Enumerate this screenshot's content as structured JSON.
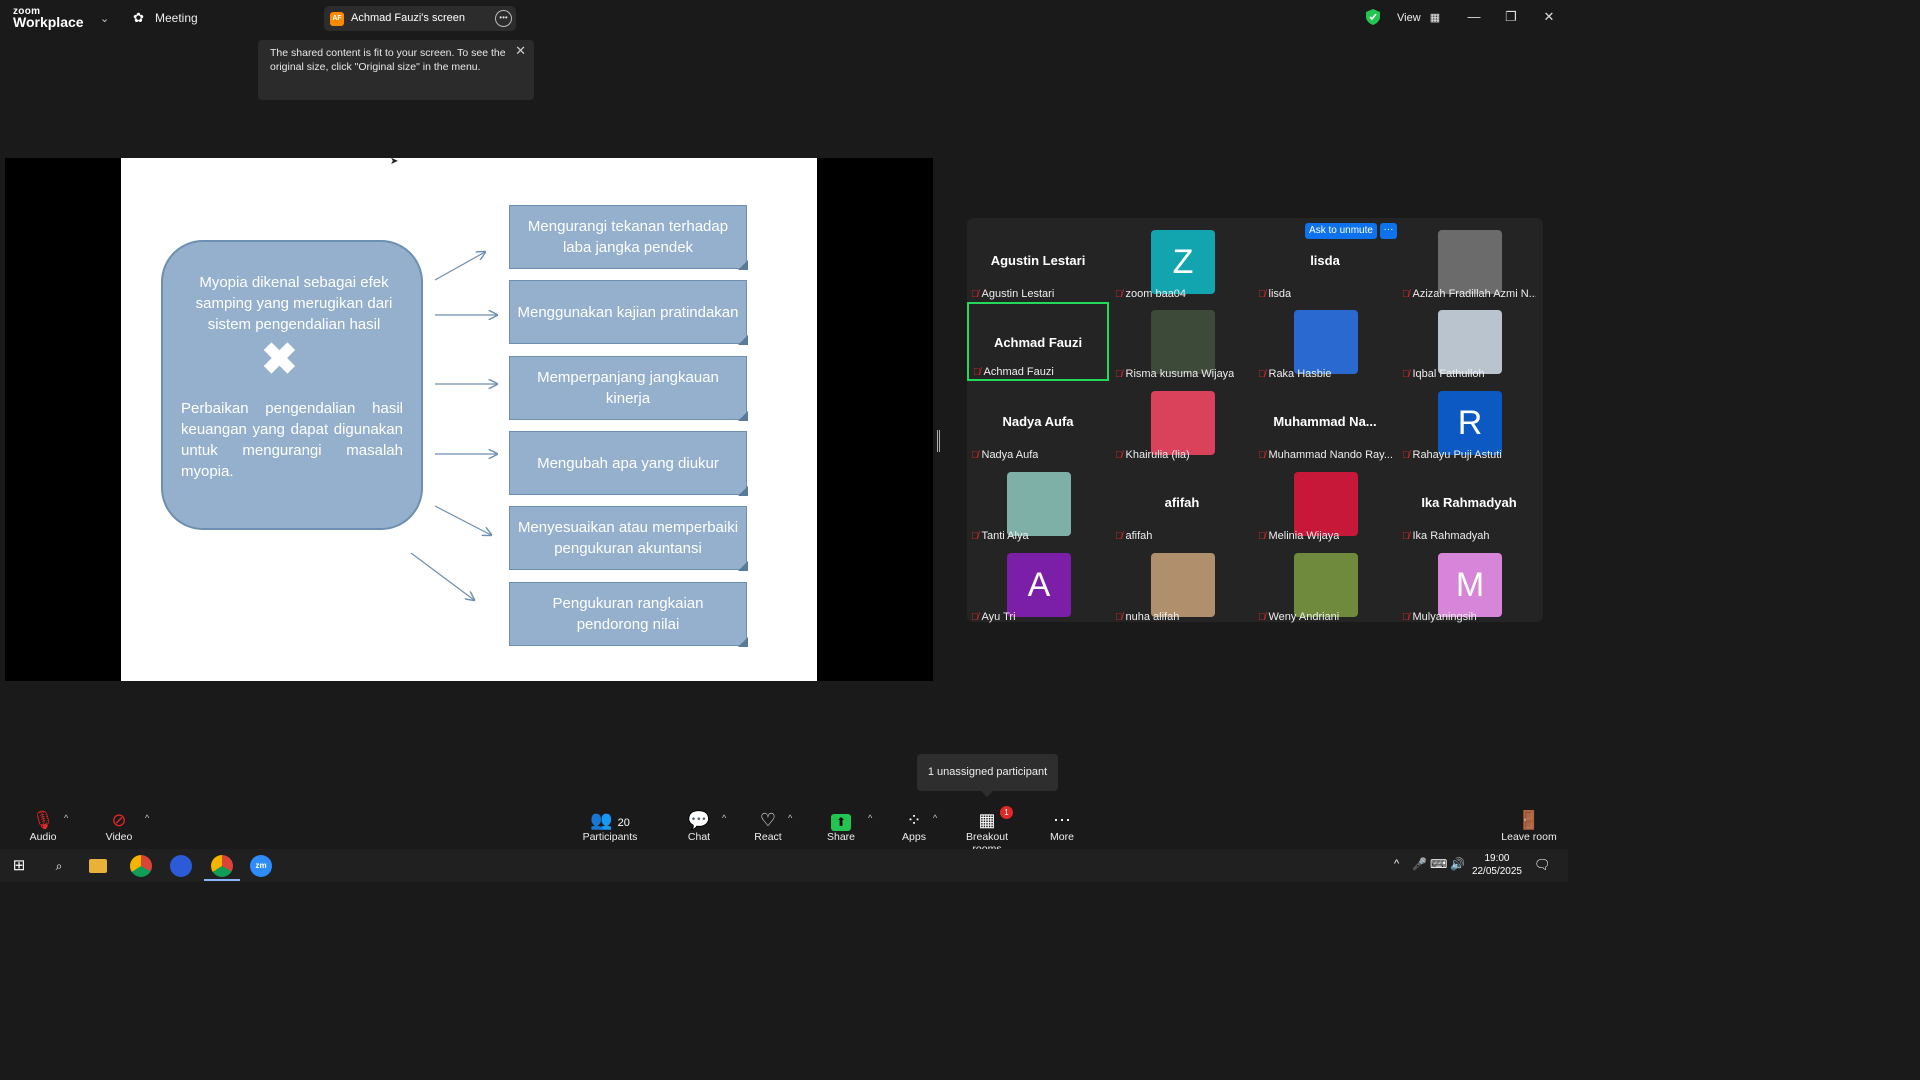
{
  "titlebar": {
    "logo_top": "zoom",
    "logo_bottom": "Workplace",
    "meeting_label": "Meeting",
    "share_initials": "AF",
    "share_title": "Achmad Fauzi's screen",
    "view_label": "View",
    "icons": [
      "chevron-down-icon",
      "meeting-icon",
      "more-icon",
      "shield-icon",
      "grid-icon",
      "minimize-icon",
      "maximize-icon",
      "close-icon"
    ]
  },
  "tooltip": {
    "text": "The shared content is fit to your screen. To see the original size, click \"Original size\" in the menu."
  },
  "slide": {
    "main_text_1": "Myopia dikenal sebagai efek samping yang merugikan dari sistem pengendalian hasil",
    "main_x": "✖",
    "main_text_2": "Perbaikan pengendalian hasil keuangan yang dapat digunakan untuk mengurangi masalah myopia.",
    "boxes": [
      "Mengurangi tekanan terhadap laba jangka pendek",
      "Menggunakan kajian pratindakan",
      "Memperpanjang jangkauan kinerja",
      "Mengubah apa yang diukur",
      "Menyesuaikan atau memperbaiki pengukuran akuntansi",
      "Pengukuran rangkaian pendorong nilai"
    ]
  },
  "gallery": {
    "ask_to_unmute": "Ask to unmute",
    "ask_more": "···",
    "tiles": [
      {
        "name": "Agustin Lestari",
        "label": "Agustin Lestari",
        "type": "name"
      },
      {
        "name": "Z",
        "label": "zoom baa04",
        "type": "letter",
        "color": "#12a5b0"
      },
      {
        "name": "lisda",
        "label": "lisda",
        "type": "name"
      },
      {
        "name": "",
        "label": "Azizah Fradillah Azmi N...",
        "type": "photo",
        "color": "#6b6b6b"
      },
      {
        "name": "Achmad Fauzi",
        "label": "Achmad Fauzi",
        "type": "name",
        "active": true
      },
      {
        "name": "",
        "label": "Risma kusuma Wijaya",
        "type": "photo",
        "color": "#3d4a3a"
      },
      {
        "name": "",
        "label": "Raka Hasbie",
        "type": "photo",
        "color": "#2a6ad0"
      },
      {
        "name": "",
        "label": "Iqbal Fathulloh",
        "type": "photo",
        "color": "#b9c4cf"
      },
      {
        "name": "Nadya Aufa",
        "label": "Nadya Aufa",
        "type": "name"
      },
      {
        "name": "",
        "label": "Khairulia (lia)",
        "type": "photo",
        "color": "#d9425a"
      },
      {
        "name": "Muhammad  Na...",
        "label": "Muhammad Nando Ray...",
        "type": "name"
      },
      {
        "name": "R",
        "label": "Rahayu Puji Astuti",
        "type": "letter",
        "color": "#0c59c4"
      },
      {
        "name": "",
        "label": "Tanti Alya",
        "type": "photo",
        "color": "#7fb0a8"
      },
      {
        "name": "afifah",
        "label": "afifah",
        "type": "name"
      },
      {
        "name": "",
        "label": "Melinia Wijaya",
        "type": "photo",
        "color": "#c7183a"
      },
      {
        "name": "Ika Rahmadyah",
        "label": "Ika Rahmadyah",
        "type": "name"
      },
      {
        "name": "A",
        "label": "Ayu Tri",
        "type": "letter",
        "color": "#7c1fa8"
      },
      {
        "name": "",
        "label": "nuha alifah",
        "type": "photo",
        "color": "#b0906c"
      },
      {
        "name": "",
        "label": "Weny Andriani",
        "type": "photo",
        "color": "#6f8a3c"
      },
      {
        "name": "M",
        "label": "Mulyaningsih",
        "type": "letter",
        "color": "#d685d8"
      }
    ]
  },
  "unassigned": "1 unassigned participant",
  "toolbar": {
    "audio": "Audio",
    "video": "Video",
    "participants_count": "20",
    "participants": "Participants",
    "chat": "Chat",
    "react": "React",
    "share": "Share",
    "apps": "Apps",
    "breakout": "Breakout rooms",
    "breakout_badge": "1",
    "more": "More",
    "leave": "Leave room"
  },
  "taskbar": {
    "time": "19:00",
    "date": "22/05/2025"
  }
}
